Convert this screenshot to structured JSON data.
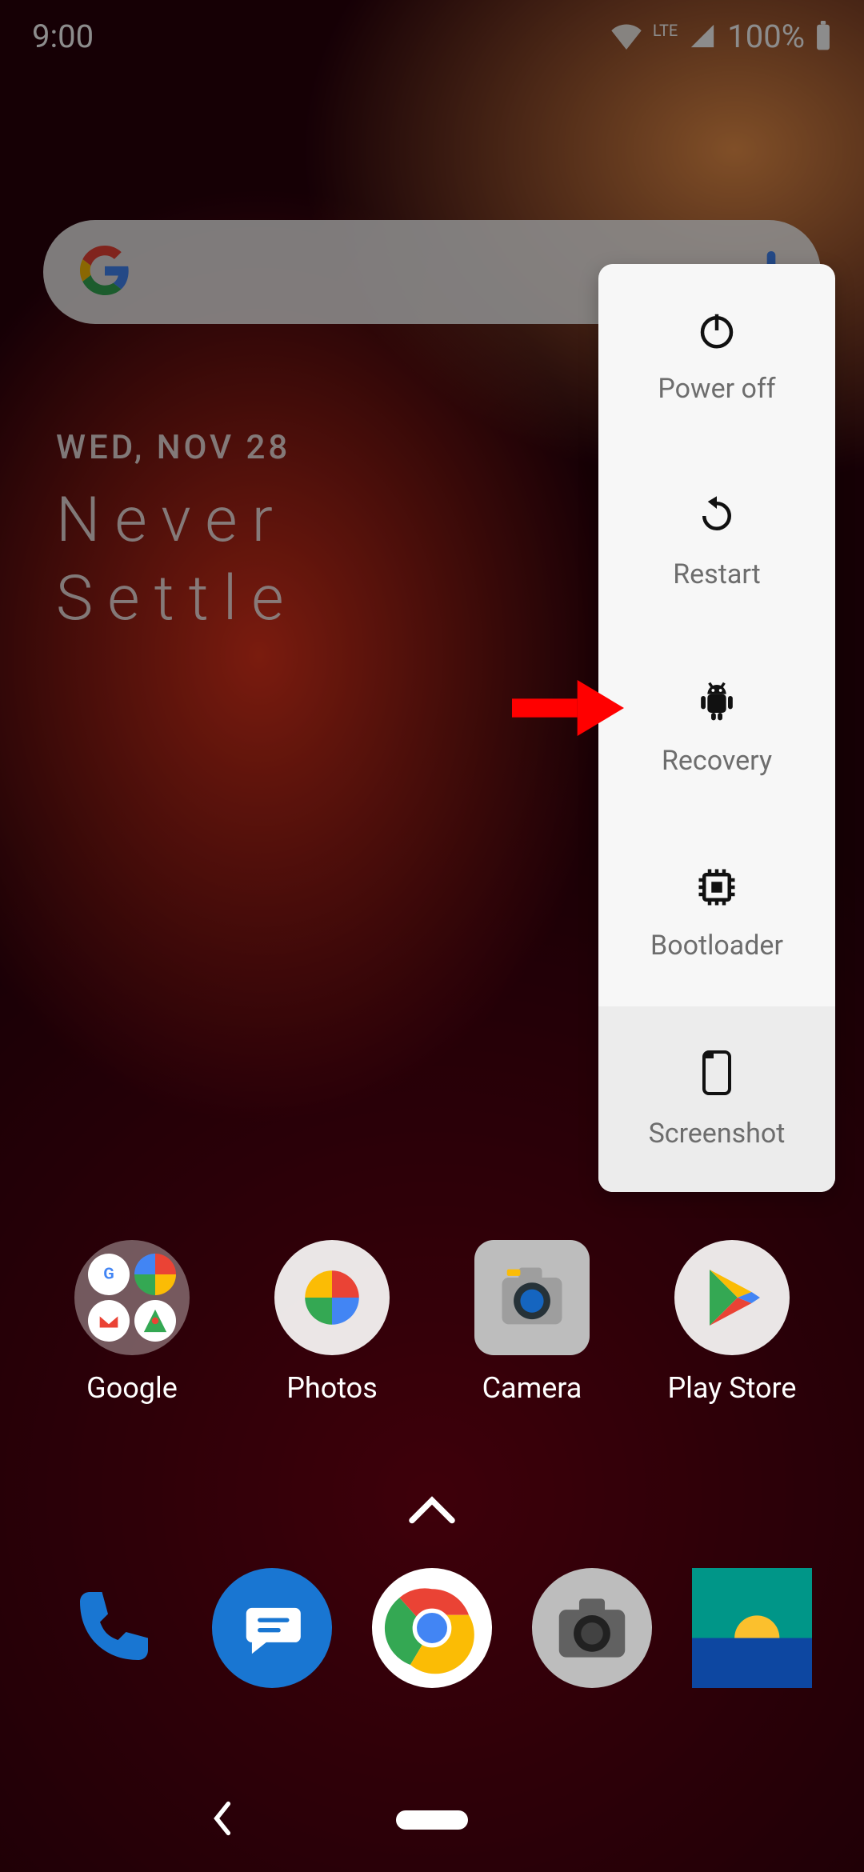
{
  "status": {
    "time": "9:00",
    "battery_pct": "100%",
    "network_label": "LTE"
  },
  "search": {
    "placeholder": ""
  },
  "date_widget": {
    "date": "WED, NOV 28",
    "tagline_line1": "Never",
    "tagline_line2": "Settle"
  },
  "power_menu": {
    "power_off": "Power off",
    "restart": "Restart",
    "recovery": "Recovery",
    "bootloader": "Bootloader",
    "screenshot": "Screenshot"
  },
  "home_apps": {
    "google_folder": "Google",
    "photos": "Photos",
    "camera": "Camera",
    "play_store": "Play Store"
  },
  "dock": {
    "phone": "Phone",
    "messages": "Messages",
    "chrome": "Chrome",
    "camera": "Camera",
    "gallery": "Gallery"
  },
  "icons": {
    "google_logo": "google-logo-icon",
    "mic": "mic-icon",
    "wifi": "wifi-icon",
    "signal": "cellular-signal-icon",
    "battery": "battery-full-icon",
    "power": "power-icon",
    "restart": "restart-icon",
    "android": "android-icon",
    "chip": "chip-icon",
    "phone_frame": "phone-frame-icon",
    "caret_up": "chevron-up-icon",
    "back": "back-icon"
  }
}
